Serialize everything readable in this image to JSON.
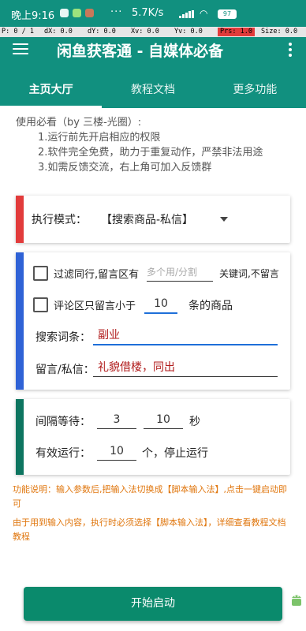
{
  "status_bar": {
    "time": "晚上9:16",
    "dots": "···",
    "network_speed": "5.7K/s",
    "battery": "97"
  },
  "debug_bar": {
    "p": "P: 0 / 1",
    "dx": "dX: 0.0",
    "dy": "dY: 0.0",
    "xv": "Xv: 0.0",
    "yv": "Yv: 0.0",
    "prs": "Prs: 1.0",
    "size": "Size: 0.0"
  },
  "app": {
    "title": "闲鱼获客通 - 自媒体必备"
  },
  "tabs": [
    {
      "label": "主页大厅",
      "active": true
    },
    {
      "label": "教程文档",
      "active": false
    },
    {
      "label": "更多功能",
      "active": false
    }
  ],
  "intro": {
    "heading": "使用必看（by 三楼-光圈）:",
    "items": [
      "1.运行前先开启相应的权限",
      "2.软件完全免费，助力于重复动作，严禁非法用途",
      "3.如需反馈交流，右上角可加入反馈群"
    ]
  },
  "mode_card": {
    "label": "执行模式：",
    "value": "【搜索商品-私信】"
  },
  "filter_card": {
    "filter_peers_label": "过滤同行,留言区有",
    "filter_peers_placeholder": "多个用/分割",
    "filter_peers_suffix": "关键词,不留言",
    "comment_limit_label": "评论区只留言小于",
    "comment_limit_value": "10",
    "comment_limit_suffix": "条的商品",
    "search_label": "搜索词条：",
    "search_value": "副业",
    "message_label": "留言/私信：",
    "message_value": "礼貌借楼，同出"
  },
  "run_card": {
    "interval_label": "间隔等待：",
    "interval_min": "3",
    "interval_max": "10",
    "interval_unit": "秒",
    "run_label": "有效运行：",
    "run_value": "10",
    "run_suffix": "个，停止运行"
  },
  "notes": {
    "note1": "功能说明：输入参数后,把输入法切换成【脚本输入法】,点击一键启动即可",
    "note2": "由于用到输入内容，执行时必须选择【脚本输入法】，详细查看教程文档教程"
  },
  "actions": {
    "start_label": "开始启动"
  },
  "colors": {
    "primary": "#11907f",
    "button": "#0a8a6c",
    "card_red": "#e23b3b",
    "card_blue": "#2f62d6",
    "card_green": "#0d7560",
    "note": "#e0770f"
  }
}
